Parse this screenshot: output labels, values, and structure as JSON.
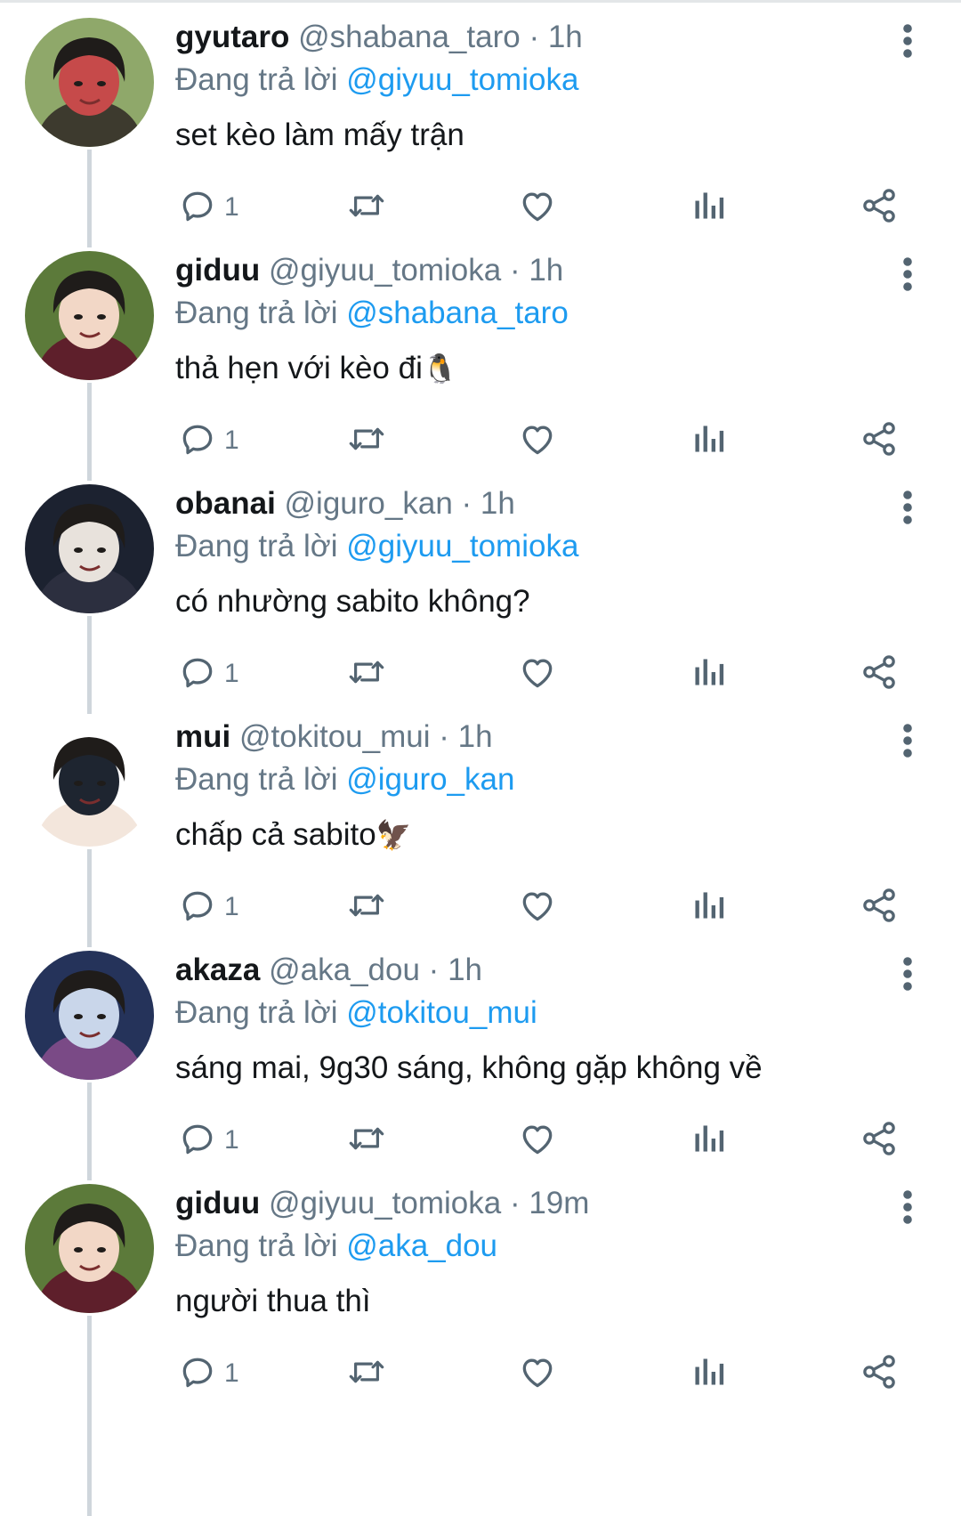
{
  "theme": {
    "accent": "#1d9bf0",
    "muted": "#657786",
    "text": "#14171a",
    "thread_line": "#cfd6dc"
  },
  "icons": {
    "reply": "reply-icon",
    "retweet": "retweet-icon",
    "like": "heart-icon",
    "views": "analytics-icon",
    "share": "share-icon",
    "more": "more-vertical-icon"
  },
  "tweets": [
    {
      "name": "gyutaro",
      "handle": "@shabana_taro",
      "sep": "·",
      "time": "1h",
      "reply_prefix": "Đang trả lời",
      "reply_to": "@giyuu_tomioka",
      "text": "set kèo làm mấy trận",
      "emoji": "",
      "reply_count": "1",
      "avatar_palette": [
        "#8fa86a",
        "#c64a4a",
        "#3d3a2e"
      ]
    },
    {
      "name": "giduu",
      "handle": "@giyuu_tomioka",
      "sep": "·",
      "time": "1h",
      "reply_prefix": "Đang trả lời",
      "reply_to": "@shabana_taro",
      "text": "thả hẹn với kèo đi",
      "emoji": "🐧",
      "reply_count": "1",
      "avatar_palette": [
        "#5c7a3a",
        "#f2d7c6",
        "#5e1f2b"
      ]
    },
    {
      "name": "obanai",
      "handle": "@iguro_kan",
      "sep": "·",
      "time": "1h",
      "reply_prefix": "Đang trả lời",
      "reply_to": "@giyuu_tomioka",
      "text": "có nhường sabito không?",
      "emoji": "",
      "reply_count": "1",
      "avatar_palette": [
        "#1c2230",
        "#e8e2dc",
        "#2c2f3f"
      ]
    },
    {
      "name": "mui",
      "handle": "@tokitou_mui",
      "sep": "·",
      "time": "1h",
      "reply_prefix": "Đang trả lời",
      "reply_to": "@iguro_kan",
      "text": "chấp cả sabito",
      "emoji": "🦅",
      "reply_count": "1",
      "avatar_palette": [
        "#ffffff",
        "#1e2530",
        "#f3e6dc"
      ]
    },
    {
      "name": "akaza",
      "handle": "@aka_dou",
      "sep": "·",
      "time": "1h",
      "reply_prefix": "Đang trả lời",
      "reply_to": "@tokitou_mui",
      "text": "sáng mai, 9g30 sáng, không gặp không về",
      "emoji": "",
      "reply_count": "1",
      "avatar_palette": [
        "#25335a",
        "#c9d6ea",
        "#7a4a86"
      ]
    },
    {
      "name": "giduu",
      "handle": "@giyuu_tomioka",
      "sep": "·",
      "time": "19m",
      "reply_prefix": "Đang trả lời",
      "reply_to": "@aka_dou",
      "text": "người thua thì",
      "emoji": "",
      "reply_count": "1",
      "avatar_palette": [
        "#5c7a3a",
        "#f2d7c6",
        "#5e1f2b"
      ]
    }
  ]
}
